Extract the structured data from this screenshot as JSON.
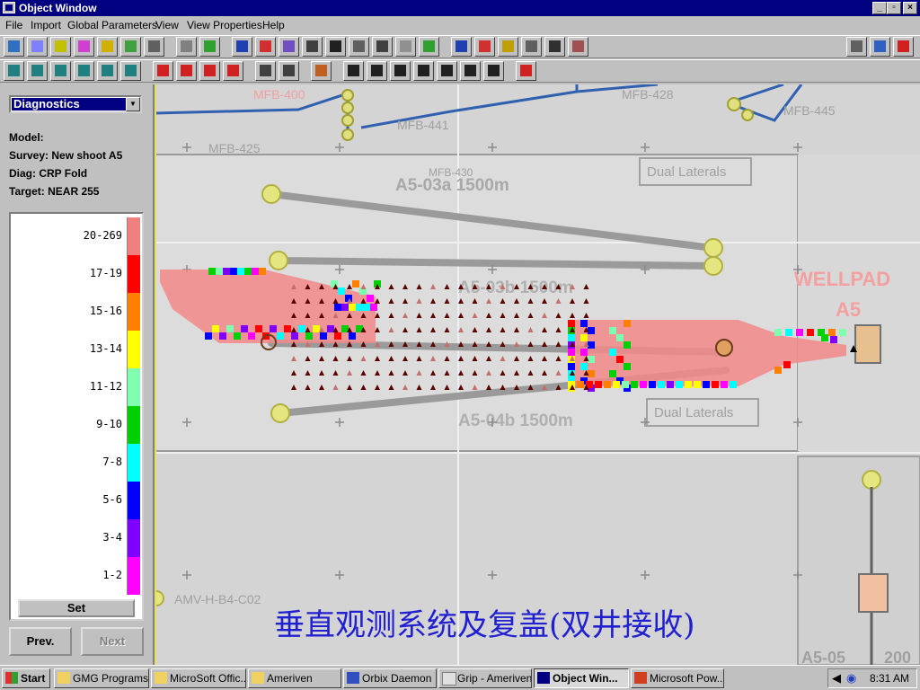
{
  "window": {
    "title": "Object Window"
  },
  "menu": [
    "File",
    "Import",
    "Global Parameters",
    "View",
    "View Properties",
    "Help"
  ],
  "sidebar": {
    "mode": "Diagnostics",
    "model_label": "Model:",
    "survey": "Survey: New shoot A5",
    "diag": "Diag: CRP Fold",
    "target": "Target: NEAR 255",
    "set_label": "Set",
    "prev_label": "Prev.",
    "next_label": "Next"
  },
  "legend": [
    {
      "label": "20-269",
      "color": "#f08080"
    },
    {
      "label": "17-19",
      "color": "#ff0000"
    },
    {
      "label": "15-16",
      "color": "#ff8000"
    },
    {
      "label": "13-14",
      "color": "#ffff00"
    },
    {
      "label": "11-12",
      "color": "#80ffb0"
    },
    {
      "label": "9-10",
      "color": "#00d000"
    },
    {
      "label": "7-8",
      "color": "#00ffff"
    },
    {
      "label": "5-6",
      "color": "#0000ff"
    },
    {
      "label": "3-4",
      "color": "#8000ff"
    },
    {
      "label": "1-2",
      "color": "#ff00ff"
    }
  ],
  "map": {
    "labels": {
      "mfb400": "MFB-400",
      "mfb428": "MFB-428",
      "mfb441": "MFB-441",
      "mfb445": "MFB-445",
      "mfb425": "MFB-425",
      "mfb430": "MFB-430",
      "a503a": "A5-03a 1500m",
      "a503b": "A5-03b 1500m",
      "a504b": "A5-04b 1500m",
      "dual1": "Dual Laterals",
      "dual2": "Dual Laterals",
      "wellpad1": "WELLPAD",
      "wellpad2": "A5",
      "amv": "AMV-H-B4-C02",
      "a505": "A5-05",
      "n200": "200"
    },
    "caption": "垂直观测系统及复盖(双井接收)"
  },
  "taskbar": {
    "start": "Start",
    "tasks": [
      "GMG Programs",
      "MicroSoft Offic...",
      "Ameriven",
      "Orbix Daemon",
      "Grip - Ameriven",
      "Object Win...",
      "Microsoft Pow..."
    ],
    "clock": "8:31 AM"
  }
}
